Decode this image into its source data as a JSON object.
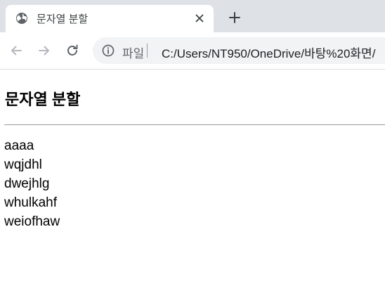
{
  "tab": {
    "title": "문자열 분할"
  },
  "omnibox": {
    "scheme_label": "파일",
    "url": "C:/Users/NT950/OneDrive/바탕%20화면/"
  },
  "page": {
    "heading": "문자열 분할",
    "results": [
      "aaaa",
      "wqjdhl",
      "dwejhlg",
      "whulkahf",
      "weiofhaw"
    ]
  },
  "colors": {
    "tabstrip_bg": "#dee1e6",
    "omnibox_bg": "#f1f3f4",
    "icon_gray": "#5f6368"
  },
  "icons": {
    "favicon": "globe-icon",
    "close": "close-icon",
    "new_tab": "plus-icon",
    "back": "back-arrow-icon",
    "forward": "forward-arrow-icon",
    "reload": "reload-icon",
    "site_info": "info-icon"
  }
}
